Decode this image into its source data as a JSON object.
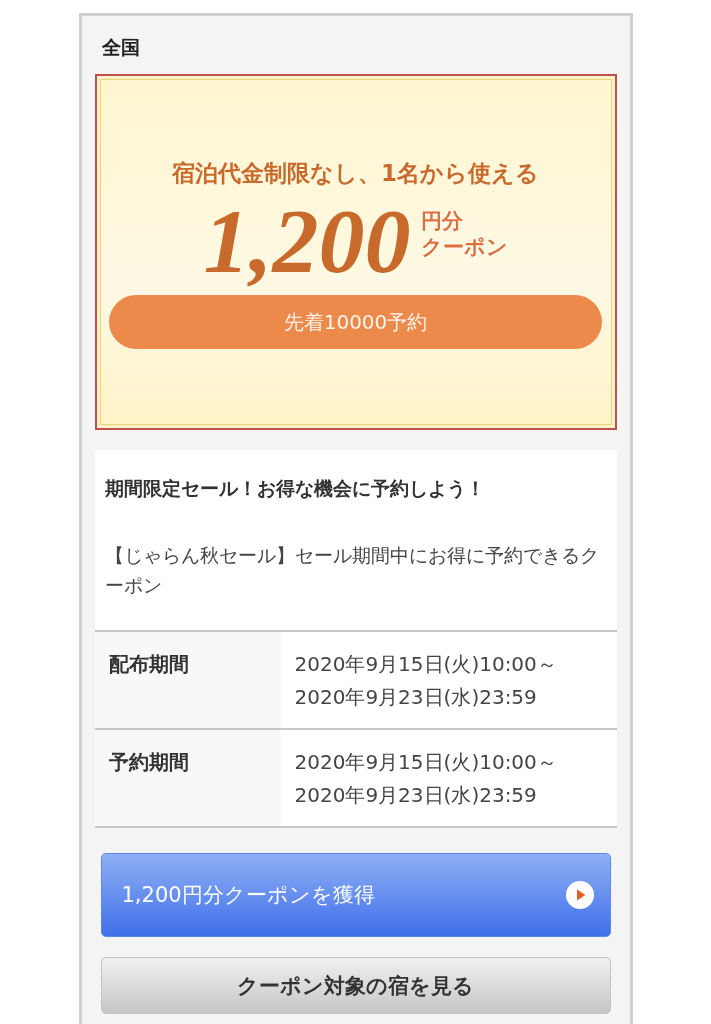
{
  "region": "全国",
  "banner": {
    "headline": "宿泊代金制限なし、1名から使える",
    "amount": "1,200",
    "unit_lines": [
      "円分",
      "クーポン"
    ],
    "limit": "先着10000予約"
  },
  "promo": {
    "title": "期間限定セール！お得な機会に予約しよう！",
    "description": "【じゃらん秋セール】セール期間中にお得に予約できるクーポン"
  },
  "periods": [
    {
      "label": "配布期間",
      "lines": [
        "2020年9月15日(火)10:00～",
        "2020年9月23日(水)23:59"
      ]
    },
    {
      "label": "予約期間",
      "lines": [
        "2020年9月15日(火)10:00～",
        "2020年9月23日(水)23:59"
      ]
    }
  ],
  "buttons": [
    {
      "kind": "primary",
      "label": "1,200円分クーポンを獲得"
    },
    {
      "kind": "secondary",
      "label": "クーポン対象の宿を見る"
    }
  ]
}
